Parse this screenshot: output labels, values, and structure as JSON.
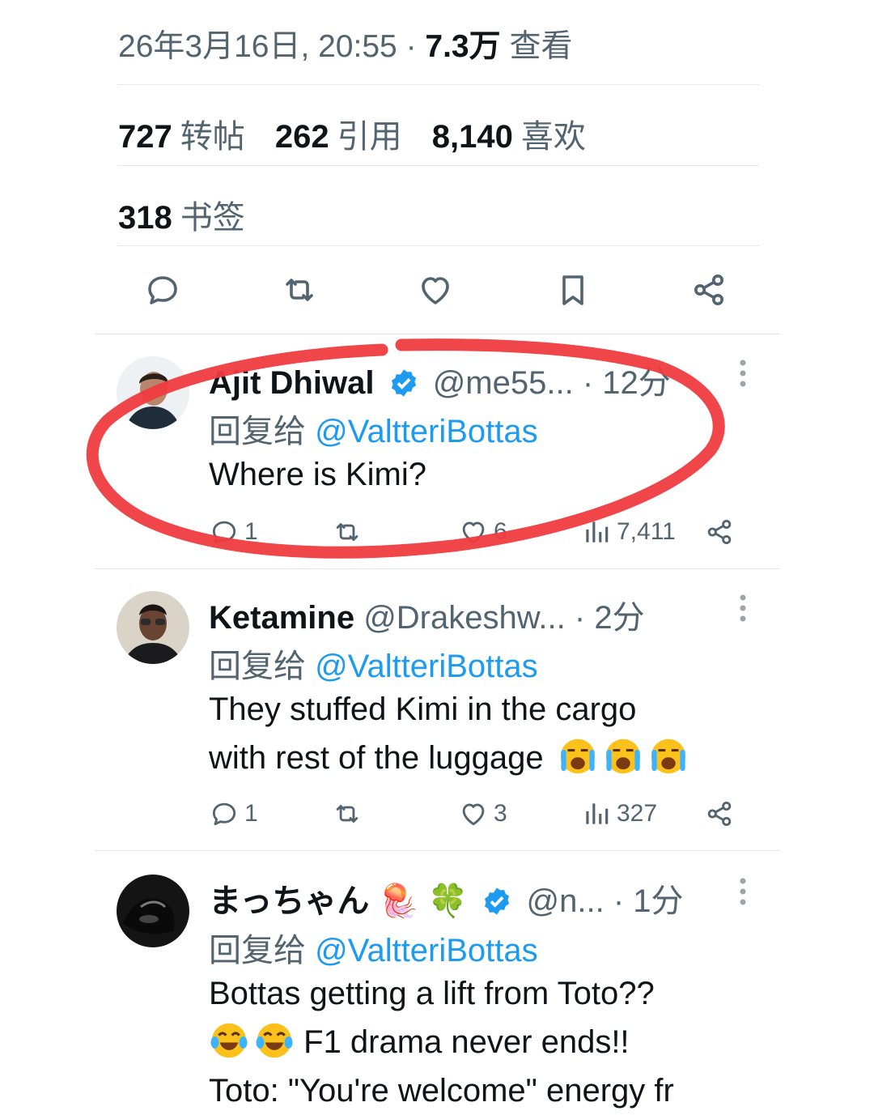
{
  "tweet_meta": {
    "datetime": "26年3月16日, 20:55",
    "separator": "·",
    "views_count": "7.3万",
    "views_label": "查看"
  },
  "stats": {
    "reposts": {
      "count": "727",
      "label": "转帖"
    },
    "quotes": {
      "count": "262",
      "label": "引用"
    },
    "likes": {
      "count": "8,140",
      "label": "喜欢"
    },
    "bookmarks": {
      "count": "318",
      "label": "书签"
    }
  },
  "actions": [
    "reply-icon",
    "repost-icon",
    "like-icon",
    "bookmark-icon",
    "share-icon"
  ],
  "colors": {
    "accent": "#1d9bf0",
    "secondary_text": "#536471",
    "annotation_red": "#ef3b3f"
  },
  "replies": [
    {
      "name": "Ajit Dhiwal",
      "verified": true,
      "handle": "@me55...",
      "time": "· 12分",
      "reply_prefix": "回复给",
      "reply_to": "@ValtteriBottas",
      "text": "Where is Kimi?",
      "reply_count": "1",
      "repost_count": "",
      "like_count": "6",
      "view_count": "7,411"
    },
    {
      "name": "Ketamine",
      "verified": false,
      "handle": "@Drakeshw...",
      "time": "· 2分",
      "reply_prefix": "回复给",
      "reply_to": "@ValtteriBottas",
      "text_line1": "They stuffed Kimi in the cargo",
      "text_line2": "with rest of the luggage",
      "reply_count": "1",
      "repost_count": "",
      "like_count": "3",
      "view_count": "327"
    },
    {
      "name": "まっちゃん",
      "name_emojis": "🪼 🍀",
      "verified": true,
      "handle": "@n...",
      "time": "· 1分",
      "reply_prefix": "回复给",
      "reply_to": "@ValtteriBottas",
      "text_line1": "Bottas getting a lift from Toto??",
      "text_line2": "F1 drama never ends!!",
      "text_line3": "Toto: \"You're welcome\" energy fr"
    }
  ]
}
